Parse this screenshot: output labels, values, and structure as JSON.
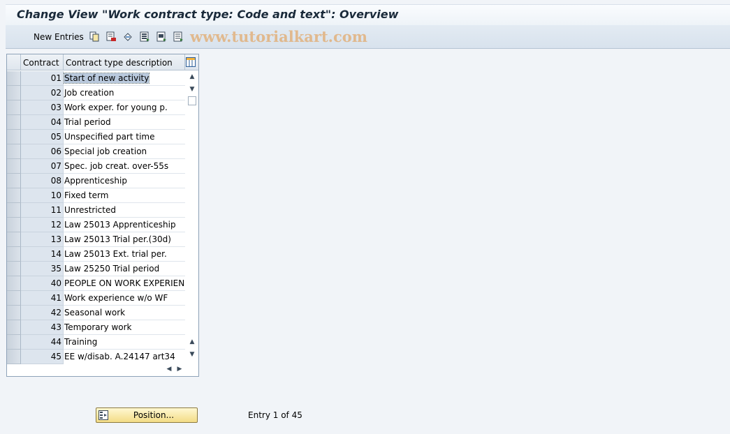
{
  "window": {
    "title": "Change View \"Work contract type: Code and text\": Overview"
  },
  "toolbar": {
    "new_entries": "New Entries",
    "icons": [
      "copy-icon",
      "delete-icon",
      "undo-change-icon",
      "select-all-icon",
      "select-block-icon",
      "deselect-all-icon"
    ],
    "watermark": "www.tutorialkart.com"
  },
  "table": {
    "columns": [
      "Contract",
      "Contract type description"
    ],
    "rows": [
      {
        "code": "01",
        "desc": "Start of new activity"
      },
      {
        "code": "02",
        "desc": "Job creation"
      },
      {
        "code": "03",
        "desc": "Work exper. for young p."
      },
      {
        "code": "04",
        "desc": "Trial period"
      },
      {
        "code": "05",
        "desc": "Unspecified part time"
      },
      {
        "code": "06",
        "desc": "Special job creation"
      },
      {
        "code": "07",
        "desc": "Spec. job creat. over-55s"
      },
      {
        "code": "08",
        "desc": "Apprenticeship"
      },
      {
        "code": "10",
        "desc": "Fixed term"
      },
      {
        "code": "11",
        "desc": "Unrestricted"
      },
      {
        "code": "12",
        "desc": "Law 25013 Apprenticeship"
      },
      {
        "code": "13",
        "desc": "Law 25013 Trial per.(30d)"
      },
      {
        "code": "14",
        "desc": "Law 25013 Ext. trial per."
      },
      {
        "code": "35",
        "desc": "Law 25250 Trial period"
      },
      {
        "code": "40",
        "desc": "PEOPLE ON WORK EXPERIENCE"
      },
      {
        "code": "41",
        "desc": "Work experience  w/o WF"
      },
      {
        "code": "42",
        "desc": "Seasonal work"
      },
      {
        "code": "43",
        "desc": "Temporary work"
      },
      {
        "code": "44",
        "desc": "Training"
      },
      {
        "code": "45",
        "desc": "EE w/disab. A.24147 art34"
      }
    ]
  },
  "footer": {
    "position_button": "Position...",
    "entry_info": "Entry 1 of 45"
  },
  "colors": {
    "accent": "#f3dc86",
    "highlight": "#b9c9dd",
    "watermark": "#e1aa6e"
  }
}
